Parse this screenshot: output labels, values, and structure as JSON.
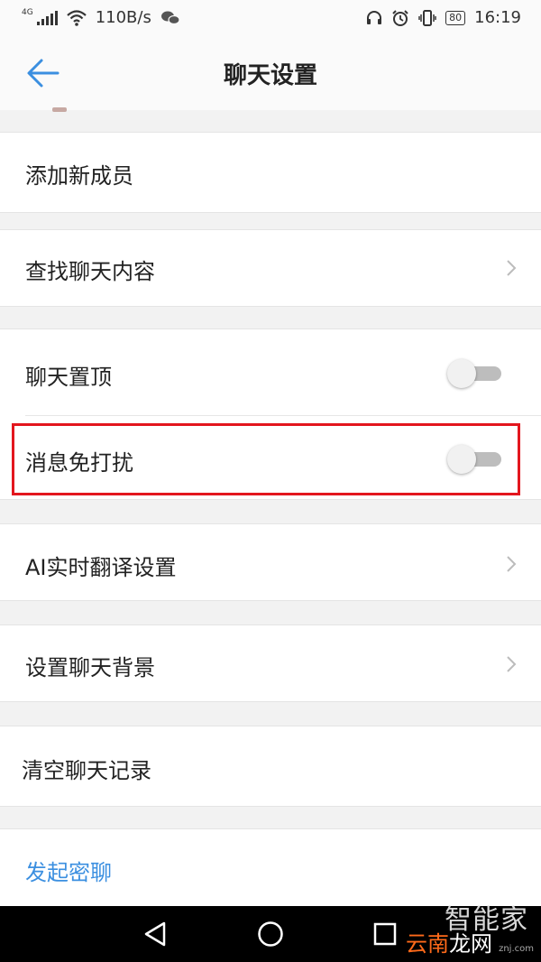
{
  "status_bar": {
    "network_label": "4G",
    "speed": "110B/s",
    "battery": "80",
    "time": "16:19",
    "icons": [
      "signal-icon",
      "wifi-icon",
      "wechat-icon",
      "headphone-icon",
      "alarm-icon",
      "vibrate-icon",
      "battery-icon"
    ]
  },
  "header": {
    "title": "聊天设置",
    "back_icon": "back-arrow-icon"
  },
  "rows": {
    "add_member": "添加新成员",
    "search_history": "查找聊天内容",
    "pin_chat": "聊天置顶",
    "mute": "消息免打扰",
    "ai_translate": "AI实时翻译设置",
    "set_background": "设置聊天背景",
    "clear_history": "清空聊天记录",
    "start_secret_chat": "发起密聊"
  },
  "toggles": {
    "pin_chat_on": false,
    "mute_on": false
  },
  "colors": {
    "accent_blue": "#3b8fe0",
    "highlight_red": "#e3161e",
    "toggle_off": "#bdbdbd"
  },
  "watermark": {
    "line1": "智能家",
    "line2_a": "云南",
    "line2_b": "龙网",
    "line3": "znj.com"
  }
}
